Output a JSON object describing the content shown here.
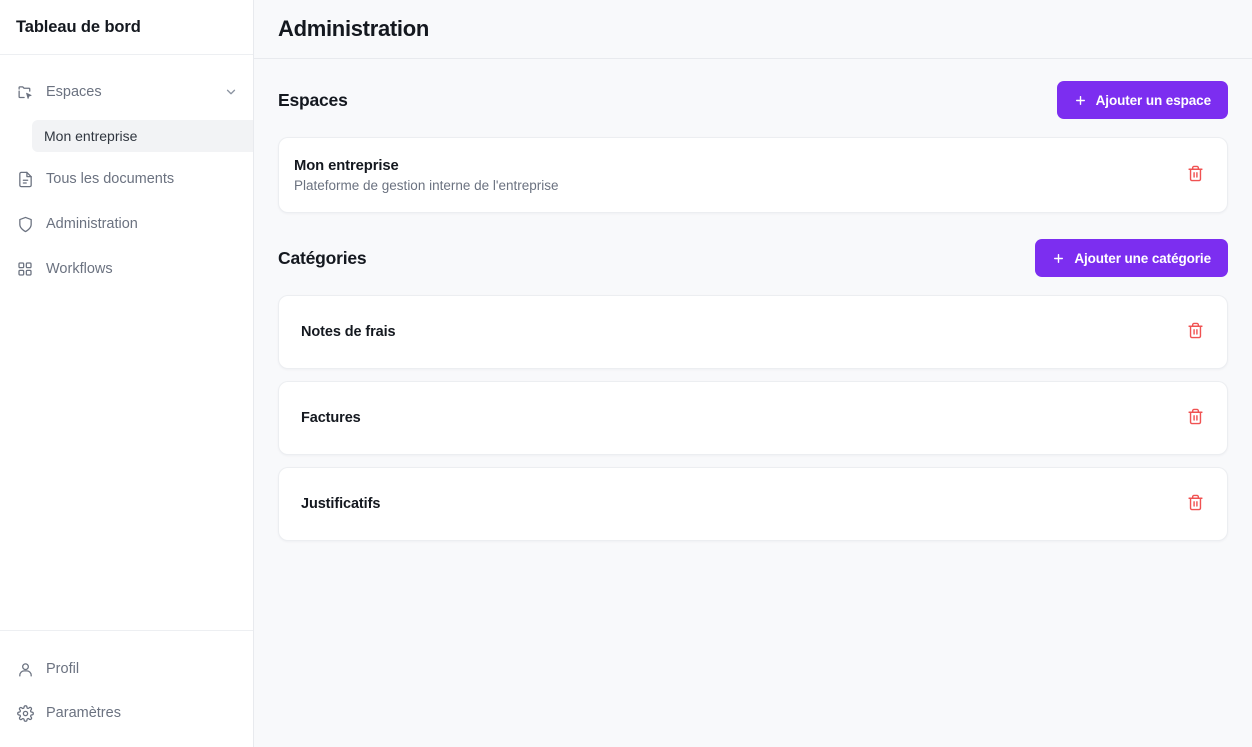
{
  "sidebar": {
    "title": "Tableau de bord",
    "nav": [
      {
        "label": "Espaces",
        "icon": "folder-cursor-icon",
        "chevron": "chevron-down-icon"
      },
      {
        "label": "Tous les documents",
        "icon": "document-icon"
      },
      {
        "label": "Administration",
        "icon": "shield-icon"
      },
      {
        "label": "Workflows",
        "icon": "grid-icon"
      }
    ],
    "sub_items": [
      {
        "label": "Mon entreprise",
        "active": true
      }
    ],
    "footer": [
      {
        "label": "Profil",
        "icon": "user-icon"
      },
      {
        "label": "Paramètres",
        "icon": "gear-icon"
      }
    ]
  },
  "header": {
    "title": "Administration"
  },
  "spaces_section": {
    "title": "Espaces",
    "add_button": "Ajouter un espace",
    "add_icon": "plus-icon",
    "items": [
      {
        "name": "Mon entreprise",
        "description": "Plateforme de gestion interne de l'entreprise",
        "delete_icon": "trash-icon"
      }
    ]
  },
  "categories_section": {
    "title": "Catégories",
    "add_button": "Ajouter une catégorie",
    "add_icon": "plus-icon",
    "items": [
      {
        "name": "Notes de frais",
        "delete_icon": "trash-icon"
      },
      {
        "name": "Factures",
        "delete_icon": "trash-icon"
      },
      {
        "name": "Justificatifs",
        "delete_icon": "trash-icon"
      }
    ]
  },
  "colors": {
    "accent": "#7c2ef0",
    "danger": "#f05252",
    "background": "#f8f9fb",
    "sidebar_bg": "#ffffff",
    "text": "#14181f",
    "muted": "#6b7280"
  }
}
